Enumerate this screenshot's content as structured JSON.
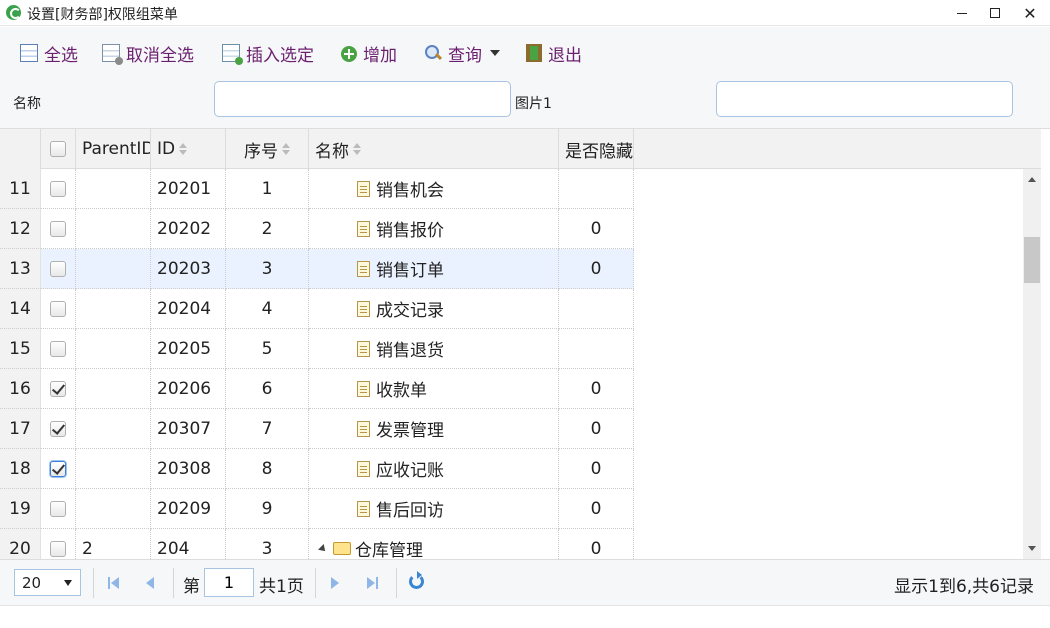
{
  "window": {
    "title": "设置[财务部]权限组菜单"
  },
  "toolbar": {
    "select_all": "全选",
    "deselect_all": "取消全选",
    "insert_selected": "插入选定",
    "add": "增加",
    "query": "查询",
    "exit": "退出"
  },
  "search": {
    "name_label": "名称",
    "name_value": "",
    "image_label": "图片1",
    "image_value": ""
  },
  "grid": {
    "columns": {
      "parent_id": "ParentID",
      "id": "ID",
      "order": "序号",
      "name": "名称",
      "hidden": "是否隐藏"
    },
    "rows": [
      {
        "rownum": "11",
        "checked": false,
        "parent": "",
        "id": "20201",
        "order": "1",
        "name": "销售机会",
        "hidden": "",
        "icon": "document-icon"
      },
      {
        "rownum": "12",
        "checked": false,
        "parent": "",
        "id": "20202",
        "order": "2",
        "name": "销售报价",
        "hidden": "0",
        "icon": "document-icon"
      },
      {
        "rownum": "13",
        "checked": false,
        "parent": "",
        "id": "20203",
        "order": "3",
        "name": "销售订单",
        "hidden": "0",
        "icon": "document-icon",
        "selected": true
      },
      {
        "rownum": "14",
        "checked": false,
        "parent": "",
        "id": "20204",
        "order": "4",
        "name": "成交记录",
        "hidden": "",
        "icon": "document-icon"
      },
      {
        "rownum": "15",
        "checked": false,
        "parent": "",
        "id": "20205",
        "order": "5",
        "name": "销售退货",
        "hidden": "",
        "icon": "document-icon"
      },
      {
        "rownum": "16",
        "checked": true,
        "parent": "",
        "id": "20206",
        "order": "6",
        "name": "收款单",
        "hidden": "0",
        "icon": "document-icon"
      },
      {
        "rownum": "17",
        "checked": true,
        "parent": "",
        "id": "20307",
        "order": "7",
        "name": "发票管理",
        "hidden": "0",
        "icon": "document-icon"
      },
      {
        "rownum": "18",
        "checked": true,
        "parent": "",
        "id": "20308",
        "order": "8",
        "name": "应收记账",
        "hidden": "0",
        "icon": "document-icon",
        "focused": true
      },
      {
        "rownum": "19",
        "checked": false,
        "parent": "",
        "id": "20209",
        "order": "9",
        "name": "售后回访",
        "hidden": "0",
        "icon": "document-icon"
      },
      {
        "rownum": "20",
        "checked": false,
        "parent": "2",
        "id": "204",
        "order": "3",
        "name": "仓库管理",
        "hidden": "0",
        "icon": "folder-icon",
        "expanded": true
      }
    ]
  },
  "pager": {
    "page_size": "20",
    "page_prefix": "第",
    "page_number": "1",
    "page_total": "共1页",
    "info": "显示1到6,共6记录"
  },
  "colors": {
    "toolbar_text": "#6b1f6f",
    "selected_row": "#eaf2ff",
    "input_border": "#a9c4e2"
  }
}
